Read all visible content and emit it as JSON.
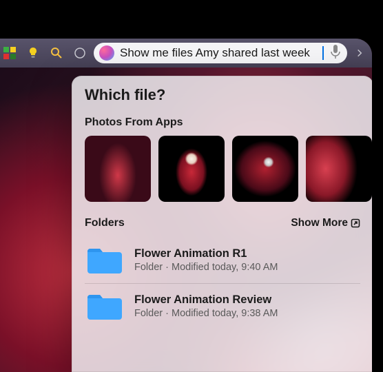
{
  "search": {
    "query": "Show me files Amy shared last week"
  },
  "results": {
    "question": "Which file?",
    "sections": {
      "photos": {
        "label": "Photos From Apps"
      },
      "folders": {
        "label": "Folders",
        "show_more": "Show More",
        "items": [
          {
            "name": "Flower Animation R1",
            "subtitle": "Folder · Modified today, 9:40 AM"
          },
          {
            "name": "Flower Animation Review",
            "subtitle": "Folder · Modified today, 9:38 AM"
          }
        ]
      }
    }
  },
  "icons": {
    "activity": "activity-monitor-icon",
    "tips": "tips-icon",
    "magnifier": "magnifier-icon",
    "siri": "siri-icon",
    "mic": "microphone-icon",
    "chevron": "chevron-right-icon",
    "popout": "popout-icon",
    "folder": "folder-icon"
  }
}
